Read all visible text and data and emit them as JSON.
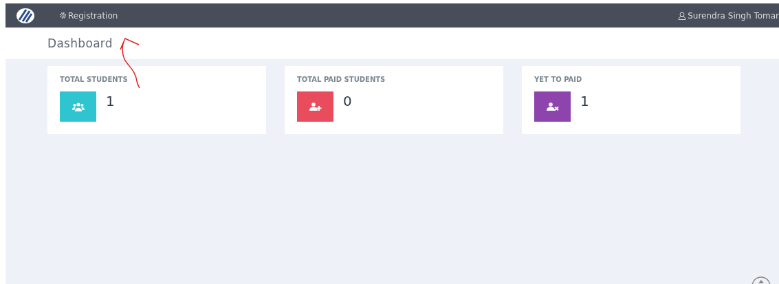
{
  "navbar": {
    "menu_item": "Registration",
    "user_name": "Surendra Singh Tomar"
  },
  "page_title": "Dashboard",
  "stats": [
    {
      "label": "TOTAL STUDENTS",
      "value": "1",
      "kind": "group",
      "color": "#2ec4d0"
    },
    {
      "label": "TOTAL PAID STUDENTS",
      "value": "0",
      "kind": "add",
      "color": "#e84c5d"
    },
    {
      "label": "YET TO PAID",
      "value": "1",
      "kind": "remove",
      "color": "#8e44ad"
    }
  ]
}
